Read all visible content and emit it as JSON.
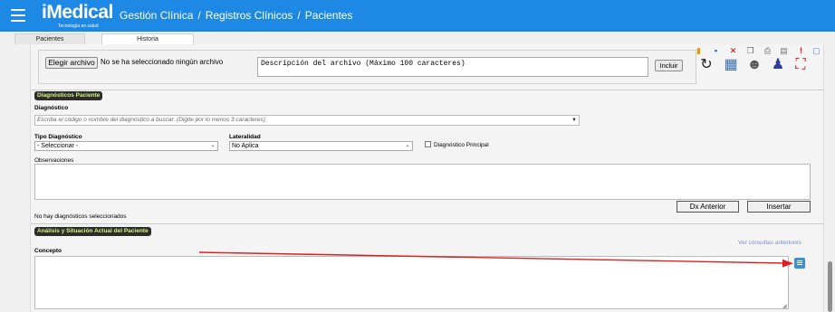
{
  "header": {
    "logo_text": "iMedical",
    "logo_tagline": "Tecnología en salud",
    "breadcrumb": [
      "Gestión Clínica",
      "Registros Clínicos",
      "Pacientes"
    ],
    "separator": "/"
  },
  "tabs": [
    {
      "label": "Pacientes"
    },
    {
      "label": "Historia"
    }
  ],
  "upload": {
    "file_button_label": "Elegir archivo",
    "file_status": "No se ha seleccionado ningún archivo",
    "description_placeholder": "Descripción del archivo (Máximo 100 caracteres)",
    "include_button_label": "Incluir"
  },
  "diagnosticos": {
    "section_title": "Diagnósticos Paciente",
    "diagnostico_label": "Diagnóstico",
    "diagnostico_placeholder": "Escriba el código o nombre del diagnóstico a buscar. (Digite por lo menos 3 caracteres)",
    "tipo_label": "Tipo Diagnóstico",
    "tipo_value": "- Seleccionar -",
    "lateralidad_label": "Lateralidad",
    "lateralidad_value": "No Aplica",
    "principal_label": "Diagnóstico Principal",
    "principal_checked": false,
    "observaciones_label": "Observaciones",
    "dx_anterior_label": "Dx Anterior",
    "insertar_label": "Insertar",
    "empty_message": "No hay diagnósticos seleccionados"
  },
  "analisis": {
    "section_title": "Análisis y Situación Actual del Paciente",
    "ver_consultas_label": "Ver consultas anteriores",
    "concepto_label": "Concepto"
  },
  "colors": {
    "header_bg": "#1e88e5",
    "section_title_bg": "#2c2c2c",
    "section_title_fg": "#d8f57a",
    "annotation_arrow": "#e02020",
    "comment_icon": "#3d8fd8"
  }
}
